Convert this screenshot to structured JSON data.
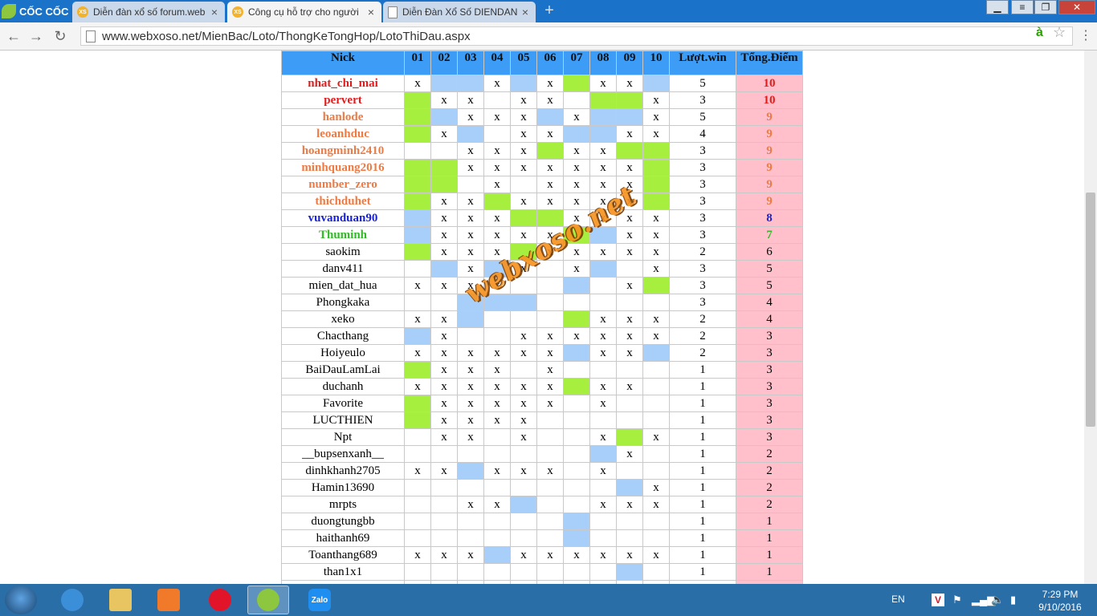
{
  "browser": {
    "logo_text": "CỐC CỐC",
    "tabs": [
      {
        "title": "Diễn đàn xổ số forum.web",
        "icon": "xs-icon",
        "fav": "XS"
      },
      {
        "title": "Công cụ hỗ trợ cho người",
        "icon": "xs-icon",
        "fav": "XS",
        "active": true
      },
      {
        "title": "Diễn Đàn Xổ Số DIENDAN",
        "icon": "page-icon",
        "fav": ""
      }
    ],
    "new_tab": "+",
    "url": "www.webxoso.net/MienBac/Loto/ThongKeTongHop/LotoThiDau.aspx",
    "ext_letter": "à"
  },
  "table": {
    "headers": [
      "Nick",
      "01",
      "02",
      "03",
      "04",
      "05",
      "06",
      "07",
      "08",
      "09",
      "10",
      "Lượt.win",
      "Tổng.Điểm"
    ],
    "rows": [
      {
        "nick": "nhat_chi_mai",
        "cells": [
          "x",
          "b",
          "b",
          "x",
          "b",
          "x",
          "g",
          "x",
          "x",
          "b"
        ],
        "win": "5",
        "pts": "10",
        "tone": "red"
      },
      {
        "nick": "pervert",
        "cells": [
          "g",
          "x",
          "x",
          "",
          "x",
          "x",
          "",
          "g",
          "g",
          "x"
        ],
        "win": "3",
        "pts": "10",
        "tone": "red"
      },
      {
        "nick": "hanlode",
        "cells": [
          "g",
          "b",
          "x",
          "x",
          "x",
          "b",
          "x",
          "b",
          "b",
          "x"
        ],
        "win": "5",
        "pts": "9",
        "tone": "orange"
      },
      {
        "nick": "leoanhduc",
        "cells": [
          "g",
          "x",
          "b",
          "",
          "x",
          "x",
          "b",
          "b",
          "x",
          "x"
        ],
        "win": "4",
        "pts": "9",
        "tone": "orange"
      },
      {
        "nick": "hoangminh2410",
        "cells": [
          "",
          "",
          "x",
          "x",
          "x",
          "g",
          "x",
          "x",
          "g",
          "g"
        ],
        "win": "3",
        "pts": "9",
        "tone": "orange"
      },
      {
        "nick": "minhquang2016",
        "cells": [
          "g",
          "g",
          "x",
          "x",
          "x",
          "x",
          "x",
          "x",
          "x",
          "g"
        ],
        "win": "3",
        "pts": "9",
        "tone": "orange"
      },
      {
        "nick": "number_zero",
        "cells": [
          "g",
          "g",
          "",
          "x",
          "",
          "x",
          "x",
          "x",
          "x",
          "g"
        ],
        "win": "3",
        "pts": "9",
        "tone": "orange"
      },
      {
        "nick": "thichduhet",
        "cells": [
          "g",
          "x",
          "x",
          "g",
          "x",
          "x",
          "x",
          "x",
          "x",
          "g"
        ],
        "win": "3",
        "pts": "9",
        "tone": "orange"
      },
      {
        "nick": "vuvanduan90",
        "cells": [
          "b",
          "x",
          "x",
          "x",
          "g",
          "g",
          "x",
          "x",
          "x",
          "x"
        ],
        "win": "3",
        "pts": "8",
        "tone": "blue"
      },
      {
        "nick": "Thuminh",
        "cells": [
          "b",
          "x",
          "x",
          "x",
          "x",
          "x",
          "g",
          "b",
          "x",
          "x"
        ],
        "win": "3",
        "pts": "7",
        "tone": "green"
      },
      {
        "nick": "saokim",
        "cells": [
          "g",
          "x",
          "x",
          "x",
          "g",
          "x",
          "x",
          "x",
          "x",
          "x"
        ],
        "win": "2",
        "pts": "6",
        "tone": "plain"
      },
      {
        "nick": "danv411",
        "cells": [
          "",
          "b",
          "x",
          "b",
          "x",
          "",
          "x",
          "b",
          "",
          "x"
        ],
        "win": "3",
        "pts": "5",
        "tone": "plain"
      },
      {
        "nick": "mien_dat_hua",
        "cells": [
          "x",
          "x",
          "x",
          "x",
          "",
          "",
          "b",
          "",
          "x",
          "g"
        ],
        "win": "3",
        "pts": "5",
        "tone": "plain"
      },
      {
        "nick": "Phongkaka",
        "cells": [
          "",
          "",
          "b",
          "b",
          "b",
          "",
          "",
          "",
          "",
          ""
        ],
        "win": "3",
        "pts": "4",
        "tone": "plain"
      },
      {
        "nick": "xeko",
        "cells": [
          "x",
          "x",
          "b",
          "",
          "",
          "",
          "g",
          "x",
          "x",
          "x"
        ],
        "win": "2",
        "pts": "4",
        "tone": "plain"
      },
      {
        "nick": "Chacthang",
        "cells": [
          "b",
          "x",
          "",
          "",
          "x",
          "x",
          "x",
          "x",
          "x",
          "x"
        ],
        "win": "2",
        "pts": "3",
        "tone": "plain"
      },
      {
        "nick": "Hoiyeulo",
        "cells": [
          "x",
          "x",
          "x",
          "x",
          "x",
          "x",
          "b",
          "x",
          "x",
          "b"
        ],
        "win": "2",
        "pts": "3",
        "tone": "plain"
      },
      {
        "nick": "BaiDauLamLai",
        "cells": [
          "g",
          "x",
          "x",
          "x",
          "",
          "x",
          "",
          "",
          "",
          ""
        ],
        "win": "1",
        "pts": "3",
        "tone": "plain"
      },
      {
        "nick": "duchanh",
        "cells": [
          "x",
          "x",
          "x",
          "x",
          "x",
          "x",
          "g",
          "x",
          "x",
          ""
        ],
        "win": "1",
        "pts": "3",
        "tone": "plain"
      },
      {
        "nick": "Favorite",
        "cells": [
          "g",
          "x",
          "x",
          "x",
          "x",
          "x",
          "",
          "x",
          "",
          ""
        ],
        "win": "1",
        "pts": "3",
        "tone": "plain"
      },
      {
        "nick": "LUCTHIEN",
        "cells": [
          "g",
          "x",
          "x",
          "x",
          "x",
          "",
          "",
          "",
          "",
          ""
        ],
        "win": "1",
        "pts": "3",
        "tone": "plain"
      },
      {
        "nick": "Npt",
        "cells": [
          "",
          "x",
          "x",
          "",
          "x",
          "",
          "",
          "x",
          "g",
          "x"
        ],
        "win": "1",
        "pts": "3",
        "tone": "plain"
      },
      {
        "nick": "__bupsenxanh__",
        "cells": [
          "",
          "",
          "",
          "",
          "",
          "",
          "",
          "b",
          "x",
          ""
        ],
        "win": "1",
        "pts": "2",
        "tone": "plain"
      },
      {
        "nick": "dinhkhanh2705",
        "cells": [
          "x",
          "x",
          "b",
          "x",
          "x",
          "x",
          "",
          "x",
          "",
          ""
        ],
        "win": "1",
        "pts": "2",
        "tone": "plain"
      },
      {
        "nick": "Hamin13690",
        "cells": [
          "",
          "",
          "",
          "",
          "",
          "",
          "",
          "",
          "b",
          "x"
        ],
        "win": "1",
        "pts": "2",
        "tone": "plain"
      },
      {
        "nick": "mrpts",
        "cells": [
          "",
          "",
          "x",
          "x",
          "b",
          "",
          "",
          "x",
          "x",
          "x"
        ],
        "win": "1",
        "pts": "2",
        "tone": "plain"
      },
      {
        "nick": "duongtungbb",
        "cells": [
          "",
          "",
          "",
          "",
          "",
          "",
          "b",
          "",
          "",
          ""
        ],
        "win": "1",
        "pts": "1",
        "tone": "plain"
      },
      {
        "nick": "haithanh69",
        "cells": [
          "",
          "",
          "",
          "",
          "",
          "",
          "b",
          "",
          "",
          ""
        ],
        "win": "1",
        "pts": "1",
        "tone": "plain"
      },
      {
        "nick": "Toanthang689",
        "cells": [
          "x",
          "x",
          "x",
          "b",
          "x",
          "x",
          "x",
          "x",
          "x",
          "x"
        ],
        "win": "1",
        "pts": "1",
        "tone": "plain"
      },
      {
        "nick": "than1x1",
        "cells": [
          "",
          "",
          "",
          "",
          "",
          "",
          "",
          "",
          "b",
          ""
        ],
        "win": "1",
        "pts": "1",
        "tone": "plain"
      },
      {
        "nick": "",
        "cells": [
          "",
          "",
          "",
          "",
          "",
          "",
          "",
          "",
          "",
          ""
        ],
        "win": "",
        "pts": "",
        "tone": "plain"
      }
    ]
  },
  "watermark": "webxoso.net",
  "colors": {
    "header": "#3d9cf5",
    "green": "#a6ef3e",
    "blue": "#a7cff9",
    "pink": "#ffc0cb"
  },
  "taskbar": {
    "apps": [
      "ie-icon",
      "explorer-icon",
      "media-icon",
      "opera-icon",
      "coccoc-icon",
      "zalo-icon"
    ],
    "zalo_label": "Zalo",
    "lang": "EN",
    "v_badge": "V",
    "time": "7:29 PM",
    "date": "9/10/2016"
  }
}
